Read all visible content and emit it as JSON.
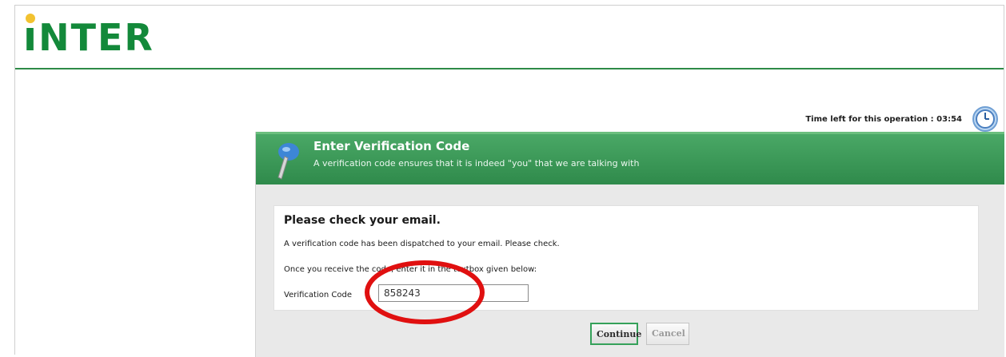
{
  "app": {
    "logo_text": "INTER",
    "brand_color": "#13893a",
    "accent_dot_color": "#f2c230"
  },
  "timer": {
    "label": "Time left for this operation : 03:54",
    "icon": "clock-icon"
  },
  "panel": {
    "icon": "pin-icon",
    "title": "Enter Verification Code",
    "subtitle": "A verification code ensures that it is indeed \"you\" that we are talking with",
    "header_color": "#3f9b5b"
  },
  "content": {
    "heading": "Please check your email.",
    "message": "A verification code has been dispatched to your email. Please check.",
    "instruction": "Once you receive the code, enter it in the textbox given below:",
    "code_label": "Verification Code",
    "code_value": "858243"
  },
  "buttons": {
    "continue_label": "Continue",
    "cancel_label": "Cancel"
  },
  "annotation": {
    "shape": "ellipse",
    "color": "#e01010"
  }
}
